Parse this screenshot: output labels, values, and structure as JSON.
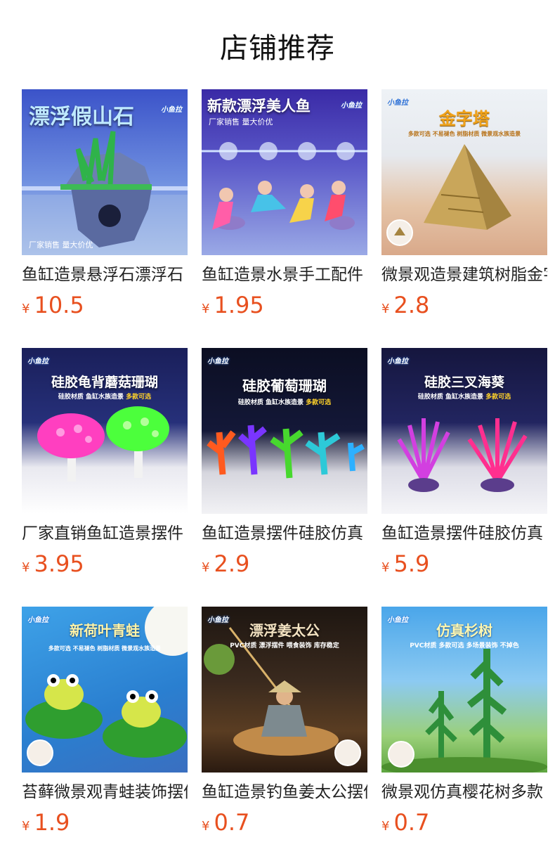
{
  "header": {
    "title": "店铺推荐"
  },
  "products": [
    {
      "name": "鱼缸造景悬浮石漂浮石",
      "price_symbol": "¥",
      "price": "10.5",
      "thumb_title": "漂浮假山石",
      "thumb_brand": "小鱼拉",
      "thumb_badge": "厂家销售 量大价优",
      "thumb_bg": [
        "#3a4fc7",
        "#8fb3e8"
      ]
    },
    {
      "name": "鱼缸造景水景手工配件",
      "price_symbol": "¥",
      "price": "1.95",
      "thumb_title": "新款漂浮美人鱼",
      "thumb_sub": "厂家销售 量大价优",
      "thumb_brand": "小鱼拉",
      "thumb_bg": [
        "#3d2aa8",
        "#7a8ee0"
      ]
    },
    {
      "name": "微景观造景建筑树脂金字塔",
      "price_symbol": "¥",
      "price": "2.8",
      "thumb_title": "金字塔",
      "thumb_sub": "多款可选 不易褪色 树脂材质 微景观水族造景",
      "thumb_brand": "小鱼拉",
      "thumb_bg": [
        "#e9eef3",
        "#e3b99a"
      ]
    },
    {
      "name": "厂家直销鱼缸造景摆件",
      "price_symbol": "¥",
      "price": "3.95",
      "thumb_title": "硅胶龟背蘑菇珊瑚",
      "thumb_sub": "硅胶材质 鱼缸水族造景",
      "thumb_sub_hl": "多款可选",
      "thumb_brand": "小鱼拉",
      "thumb_bg": [
        "#1a1f5a",
        "#e7e7ee"
      ]
    },
    {
      "name": "鱼缸造景摆件硅胶仿真",
      "price_symbol": "¥",
      "price": "2.9",
      "thumb_title": "硅胶葡萄珊瑚",
      "thumb_sub": "硅胶材质 鱼缸水族造景",
      "thumb_sub_hl": "多款可选",
      "thumb_brand": "小鱼拉",
      "thumb_bg": [
        "#0c0f24",
        "#d9d9e0"
      ]
    },
    {
      "name": "鱼缸造景摆件硅胶仿真",
      "price_symbol": "¥",
      "price": "5.9",
      "thumb_title": "硅胶三叉海葵",
      "thumb_sub": "硅胶材质 鱼缸水族造景",
      "thumb_sub_hl": "多款可选",
      "thumb_brand": "小鱼拉",
      "thumb_bg": [
        "#15163e",
        "#e8e8ef"
      ]
    },
    {
      "name": "苔藓微景观青蛙装饰摆件",
      "price_symbol": "¥",
      "price": "1.9",
      "thumb_title": "新荷叶青蛙",
      "thumb_sub": "多款可选 不易褪色 树脂材质 微景观水族造景",
      "thumb_brand": "小鱼拉",
      "thumb_bg": [
        "#2e86d8",
        "#2f6fc4"
      ]
    },
    {
      "name": "鱼缸造景钓鱼姜太公摆件",
      "price_symbol": "¥",
      "price": "0.7",
      "thumb_title": "漂浮姜太公",
      "thumb_sub": "PVC材质 漂浮摆件 喂食装饰 库存稳定",
      "thumb_brand": "小鱼拉",
      "thumb_bg": [
        "#2a1d16",
        "#8b5a2b"
      ]
    },
    {
      "name": "微景观仿真樱花树多款",
      "price_symbol": "¥",
      "price": "0.7",
      "thumb_title": "仿真杉树",
      "thumb_sub": "PVC材质 多款可选 多场景装饰 不掉色",
      "thumb_brand": "小鱼拉",
      "thumb_bg": [
        "#5bb4ec",
        "#7ec060"
      ]
    }
  ]
}
